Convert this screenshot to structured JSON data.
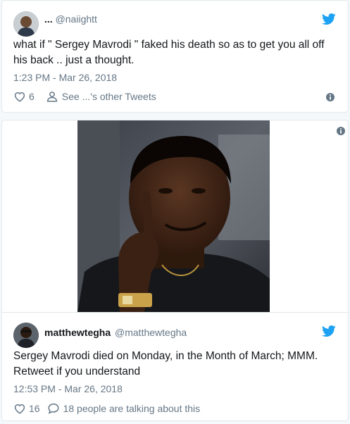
{
  "tweet1": {
    "display_name": "...",
    "handle": "@naiightt",
    "text": "what if \" Sergey Mavrodi \" faked his death so as to get you all off his back .. just a thought.",
    "timestamp": "1:23 PM - Mar 26, 2018",
    "likes": "6",
    "other_tweets_label": "See ...'s other Tweets"
  },
  "tweet2": {
    "display_name": "matthewtegha",
    "handle": "@matthewtegha",
    "text": "Sergey Mavrodi died on Monday, in the Month of March; MMM. Retweet if you understand",
    "timestamp": "12:53 PM - Mar 26, 2018",
    "likes": "16",
    "conversation_label": "18 people are talking about this"
  },
  "icons": {
    "twitter": "twitter-bird-icon",
    "like": "heart-icon",
    "profile": "person-icon",
    "reply": "speech-bubble-icon",
    "info": "info-icon"
  },
  "colors": {
    "twitter_blue": "#1da1f2",
    "secondary_text": "#657786",
    "border": "#e1e8ed",
    "background": "#f5f8fa"
  }
}
